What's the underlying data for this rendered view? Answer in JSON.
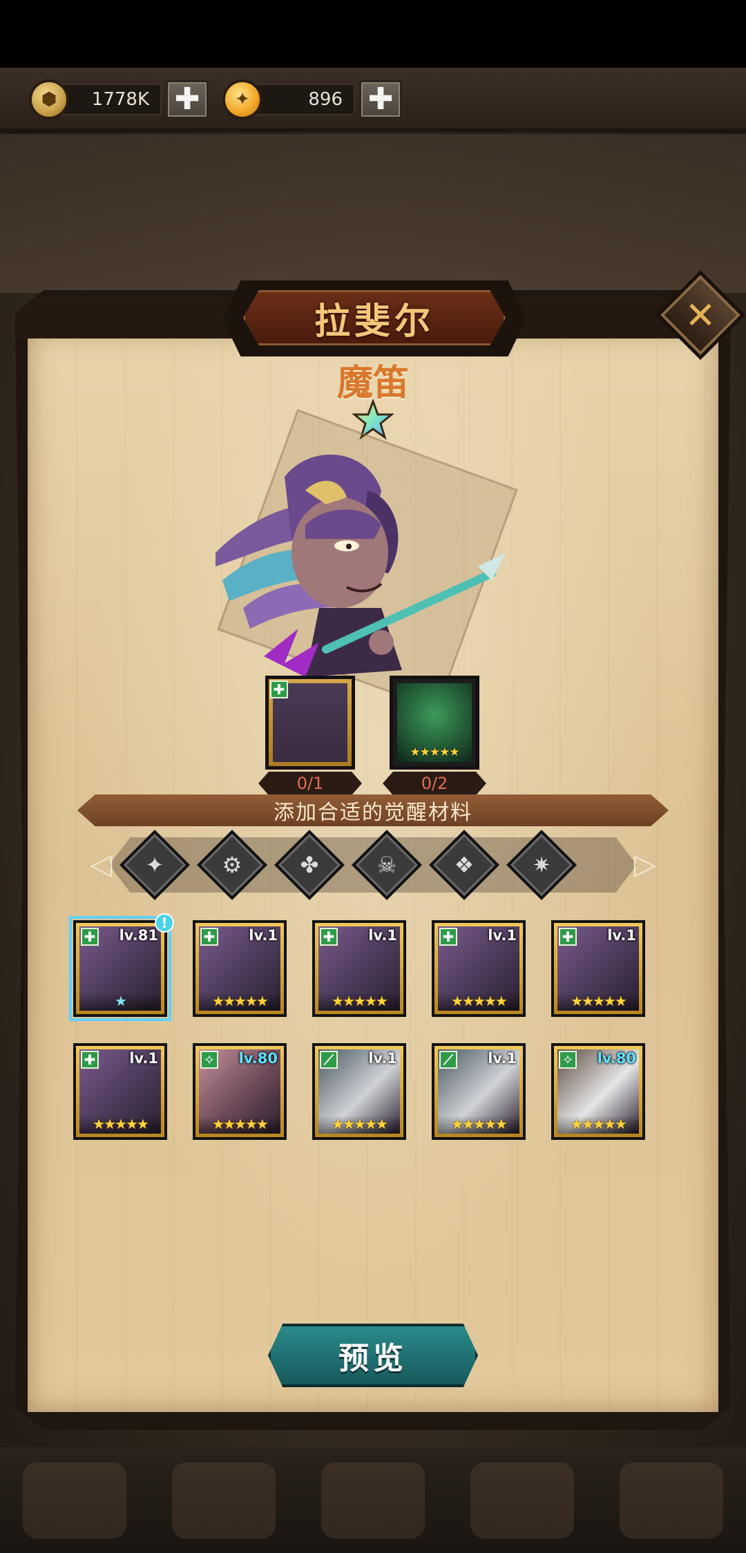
{
  "currency": {
    "gold_amount": "1778K",
    "gem_amount": "896",
    "plus_label": "✚",
    "gold_icon": "gold-coin-icon",
    "gem_icon": "crystal-coin-icon"
  },
  "dialog": {
    "hero_name": "拉斐尔",
    "hero_class": "魔笛",
    "close_label": "✕",
    "star_count": 1
  },
  "requirements": {
    "hero_count": "0/1",
    "generic_count": "0/2",
    "generic_stars": "★★★★★"
  },
  "banner": {
    "text": "添加合适的觉醒材料"
  },
  "filters": [
    {
      "name": "filter-angel-icon",
      "glyph": "✦"
    },
    {
      "name": "filter-gear-icon",
      "glyph": "⚙"
    },
    {
      "name": "filter-clover-icon",
      "glyph": "✤"
    },
    {
      "name": "filter-skull-icon",
      "glyph": "☠"
    },
    {
      "name": "filter-wing-icon",
      "glyph": "❖"
    },
    {
      "name": "filter-demon-icon",
      "glyph": "✷"
    }
  ],
  "heroes": [
    {
      "level": "lv.81",
      "stars": "★",
      "star_color": "blue",
      "badge": "✚",
      "badge_color": "#2e9b4a",
      "selected": true,
      "alert": "!",
      "palette": [
        "#4a3a58",
        "#7b5a8c"
      ]
    },
    {
      "level": "lv.1",
      "stars": "★★★★★",
      "star_color": "gold",
      "badge": "✚",
      "badge_color": "#2e9b4a",
      "palette": [
        "#4a3a58",
        "#7b5a8c"
      ]
    },
    {
      "level": "lv.1",
      "stars": "★★★★★",
      "star_color": "gold",
      "badge": "✚",
      "badge_color": "#2e9b4a",
      "palette": [
        "#4a3a58",
        "#7b5a8c"
      ]
    },
    {
      "level": "lv.1",
      "stars": "★★★★★",
      "star_color": "gold",
      "badge": "✚",
      "badge_color": "#2e9b4a",
      "palette": [
        "#4a3a58",
        "#7b5a8c"
      ]
    },
    {
      "level": "lv.1",
      "stars": "★★★★★",
      "star_color": "gold",
      "badge": "✚",
      "badge_color": "#2e9b4a",
      "palette": [
        "#4a3a58",
        "#7b5a8c"
      ]
    },
    {
      "level": "lv.1",
      "stars": "★★★★★",
      "star_color": "gold",
      "badge": "✚",
      "badge_color": "#2e9b4a",
      "palette": [
        "#4a3a58",
        "#7b5a8c"
      ]
    },
    {
      "level": "lv.80",
      "stars": "★★★★★",
      "star_color": "gold",
      "badge": "✧",
      "badge_color": "#2e9b4a",
      "level_color": "blue",
      "palette": [
        "#6d4a5a",
        "#c4909a"
      ]
    },
    {
      "level": "lv.1",
      "stars": "★★★★★",
      "star_color": "gold",
      "badge": "⟋",
      "badge_color": "#2e9b4a",
      "palette": [
        "#cfd2d6",
        "#4a5860"
      ]
    },
    {
      "level": "lv.1",
      "stars": "★★★★★",
      "star_color": "gold",
      "badge": "⟋",
      "badge_color": "#2e9b4a",
      "palette": [
        "#cfd2d6",
        "#4a5860"
      ]
    },
    {
      "level": "lv.80",
      "stars": "★★★★★",
      "star_color": "gold",
      "badge": "✧",
      "badge_color": "#2e9b4a",
      "level_color": "blue",
      "palette": [
        "#e6e6e6",
        "#5a4a40"
      ]
    }
  ],
  "preview_label": "预览",
  "colors": {
    "accent_title": "#f5c77a",
    "class_text": "#d9782d",
    "count_text": "#e06b52",
    "preview_button": "#2b8a8a"
  }
}
